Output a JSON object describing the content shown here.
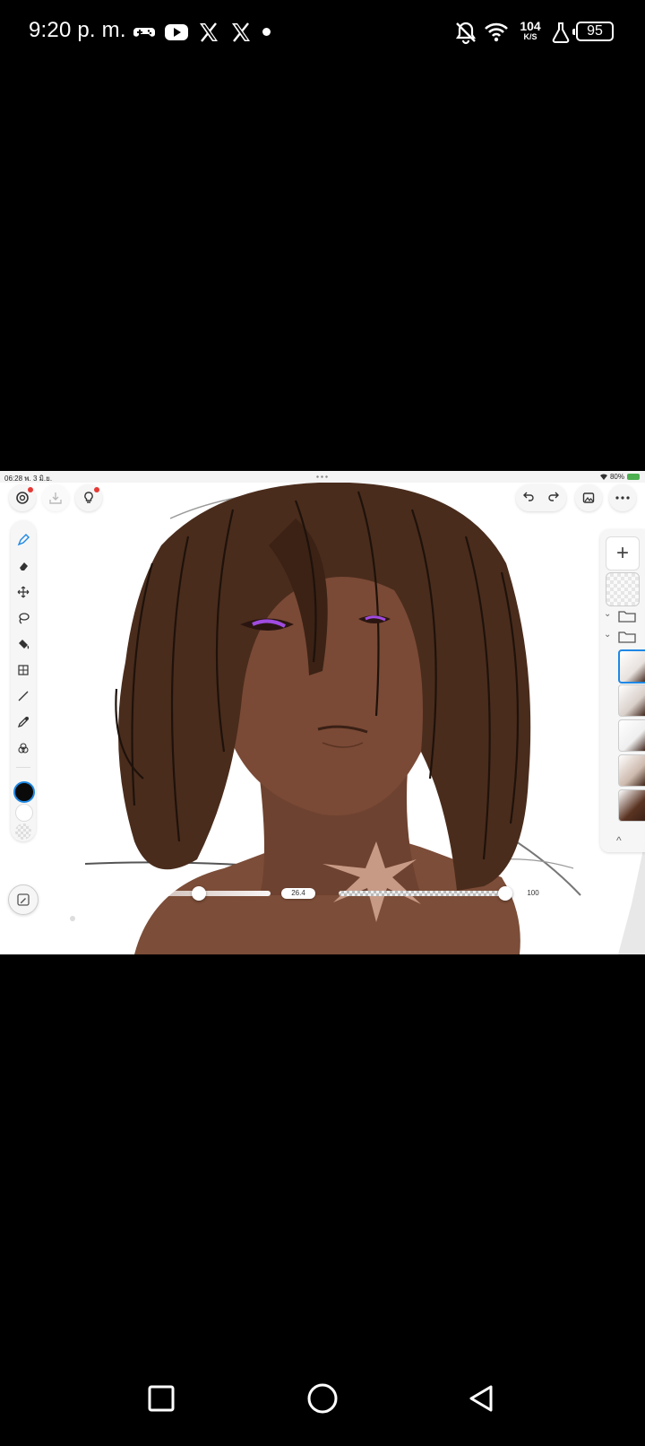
{
  "phone_status": {
    "time": "9:20 p. m.",
    "notification_icons": [
      "gamepad-icon",
      "youtube-icon",
      "x-logo-icon",
      "x-logo-icon",
      "more-dot-icon"
    ],
    "net_speed_value": "104",
    "net_speed_unit": "K/S",
    "battery": "95"
  },
  "tablet_status": {
    "time": "06:28  พ. 3 มิ.ย.",
    "battery_text": "80%"
  },
  "toolbar": {
    "tools": [
      "brush-icon",
      "eraser-icon",
      "move-icon",
      "lasso-icon",
      "fill-icon",
      "transform-grid-icon",
      "line-icon",
      "eyedropper-icon",
      "color-wheel-icon"
    ],
    "primary_color": "#0a0a0a",
    "secondary_color": "#ffffff"
  },
  "sliders": {
    "brush_size_value": "26.4",
    "brush_size_fraction": 0.58,
    "opacity_value": "100",
    "opacity_fraction": 1.0
  },
  "layers": {
    "add_symbol": "+",
    "thumbnail_count": 5,
    "selected_index": 0
  },
  "colors": {
    "hair": "#4a2c1c",
    "skin": "#7a4a36",
    "accent_blue": "#1e88e5",
    "notify_red": "#e53935"
  }
}
